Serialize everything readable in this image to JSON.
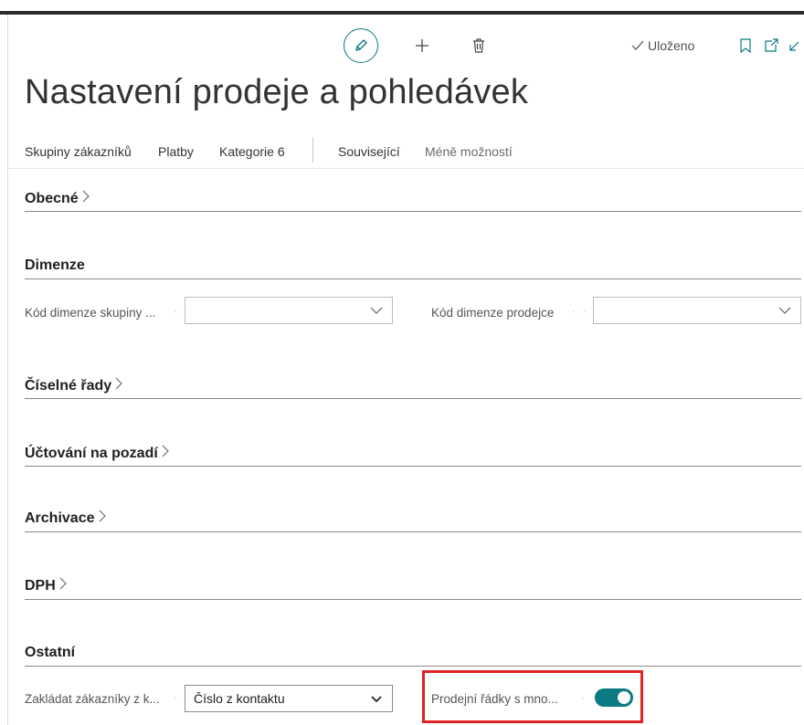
{
  "actions": {
    "saved_label": "Uloženo"
  },
  "page": {
    "title": "Nastavení prodeje a pohledávek"
  },
  "nav": {
    "items": [
      "Skupiny zákazníků",
      "Platby",
      "Kategorie 6",
      "Související",
      "Méně možností"
    ]
  },
  "sections": {
    "general": "Obecné",
    "dimensions": "Dimenze",
    "number_series": "Číselné řady",
    "background_posting": "Účtování na pozadí",
    "archiving": "Archivace",
    "vat": "DPH",
    "other": "Ostatní"
  },
  "fields": {
    "customer_group_dimension": {
      "label": "Kód dimenze skupiny ...",
      "value": ""
    },
    "salesperson_dimension": {
      "label": "Kód dimenze prodejce",
      "value": ""
    },
    "create_customers_from": {
      "label": "Zakládat zákazníky z k...",
      "value": "Číslo z kontaktu"
    },
    "sales_lines_multiple": {
      "label": "Prodejní řádky s mno...",
      "value": true
    }
  },
  "colors": {
    "accent": "#0b7a83",
    "highlight": "#e02424"
  }
}
